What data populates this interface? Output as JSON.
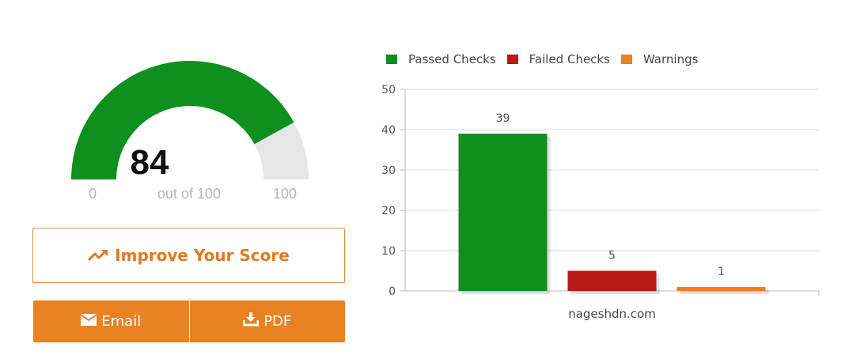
{
  "gauge": {
    "score": "84",
    "out_of": "out of 100",
    "min": "0",
    "max": "100",
    "value": 84,
    "max_value": 100,
    "fill_color": "#0e8f1e",
    "track_color": "#e6e6e6"
  },
  "improve_button": {
    "label": "Improve Your Score",
    "icon": "trending-up-icon",
    "color": "#e07a20"
  },
  "share": {
    "email_label": "Email",
    "email_icon": "envelope-icon",
    "pdf_label": "PDF",
    "pdf_icon": "download-icon",
    "color": "#e88223"
  },
  "chart_data": {
    "type": "bar",
    "categories": [
      "nageshdn.com"
    ],
    "series": [
      {
        "name": "Passed Checks",
        "values": [
          39
        ],
        "color": "#0e8f1e"
      },
      {
        "name": "Failed Checks",
        "values": [
          5
        ],
        "color": "#b81a16"
      },
      {
        "name": "Warnings",
        "values": [
          1
        ],
        "color": "#e88223"
      }
    ],
    "ylim": [
      0,
      50
    ],
    "yticks": [
      0,
      10,
      20,
      30,
      40,
      50
    ],
    "grid": true,
    "legend": "top-left",
    "data_labels": true
  }
}
